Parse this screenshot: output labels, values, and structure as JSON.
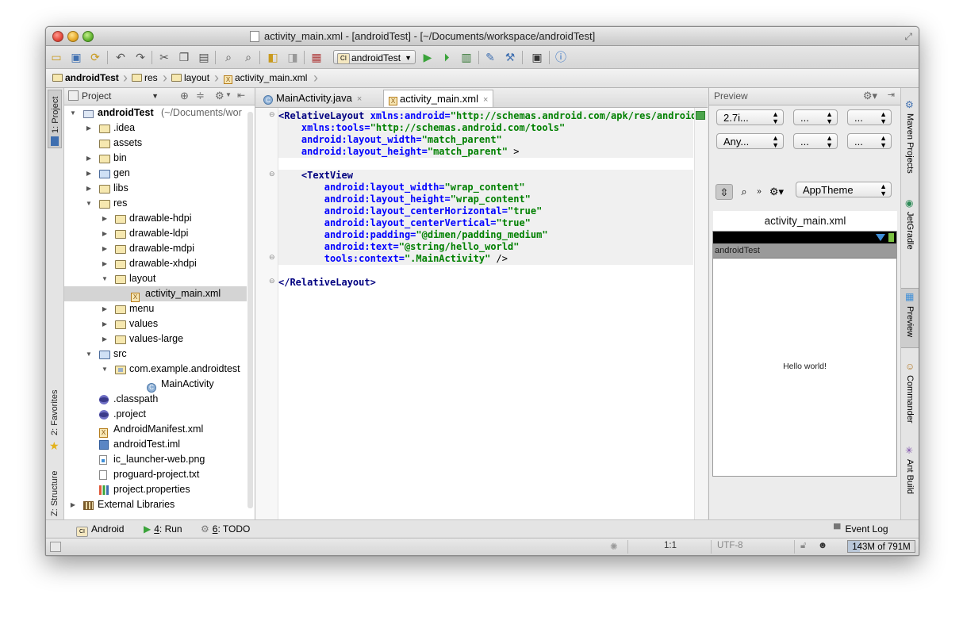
{
  "window": {
    "title": "activity_main.xml - [androidTest] - [~/Documents/workspace/androidTest]"
  },
  "toolbar": {
    "run_config": "androidTest",
    "run_config_badge": "CI"
  },
  "breadcrumbs": [
    "androidTest",
    "res",
    "layout",
    "activity_main.xml"
  ],
  "left_stripe": {
    "project": "1: Project",
    "favorites": "2: Favorites",
    "structure": "Z: Structure"
  },
  "project_panel": {
    "view_mode": "Project",
    "tree": [
      {
        "label": "androidTest",
        "suffix": " (~/Documents/wor",
        "depth": 0,
        "expanded": true,
        "icon": "module-folder-icon",
        "bold": true
      },
      {
        "label": ".idea",
        "depth": 1,
        "expanded": false,
        "icon": "folder-icon"
      },
      {
        "label": "assets",
        "depth": 1,
        "leaf": true,
        "icon": "folder-icon"
      },
      {
        "label": "bin",
        "depth": 1,
        "expanded": false,
        "icon": "folder-icon"
      },
      {
        "label": "gen",
        "depth": 1,
        "expanded": false,
        "icon": "source-folder-icon"
      },
      {
        "label": "libs",
        "depth": 1,
        "expanded": false,
        "icon": "folder-icon"
      },
      {
        "label": "res",
        "depth": 1,
        "expanded": true,
        "icon": "folder-icon"
      },
      {
        "label": "drawable-hdpi",
        "depth": 2,
        "expanded": false,
        "icon": "folder-icon"
      },
      {
        "label": "drawable-ldpi",
        "depth": 2,
        "expanded": false,
        "icon": "folder-icon"
      },
      {
        "label": "drawable-mdpi",
        "depth": 2,
        "expanded": false,
        "icon": "folder-icon"
      },
      {
        "label": "drawable-xhdpi",
        "depth": 2,
        "expanded": false,
        "icon": "folder-icon"
      },
      {
        "label": "layout",
        "depth": 2,
        "expanded": true,
        "icon": "folder-icon"
      },
      {
        "label": "activity_main.xml",
        "depth": 3,
        "leaf": true,
        "icon": "xml-file-icon",
        "selected": true
      },
      {
        "label": "menu",
        "depth": 2,
        "expanded": false,
        "icon": "folder-icon"
      },
      {
        "label": "values",
        "depth": 2,
        "expanded": false,
        "icon": "folder-icon"
      },
      {
        "label": "values-large",
        "depth": 2,
        "expanded": false,
        "icon": "folder-icon"
      },
      {
        "label": "src",
        "depth": 1,
        "expanded": true,
        "icon": "source-folder-icon"
      },
      {
        "label": "com.example.androidtest",
        "depth": 2,
        "expanded": true,
        "icon": "package-icon"
      },
      {
        "label": "MainActivity",
        "depth": 4,
        "leaf": true,
        "icon": "class-icon"
      },
      {
        "label": ".classpath",
        "depth": 1,
        "leaf": true,
        "icon": "eclipse-file-icon"
      },
      {
        "label": ".project",
        "depth": 1,
        "leaf": true,
        "icon": "eclipse-file-icon"
      },
      {
        "label": "AndroidManifest.xml",
        "depth": 1,
        "leaf": true,
        "icon": "xml-file-icon"
      },
      {
        "label": "androidTest.iml",
        "depth": 1,
        "leaf": true,
        "icon": "iml-file-icon"
      },
      {
        "label": "ic_launcher-web.png",
        "depth": 1,
        "leaf": true,
        "icon": "image-file-icon"
      },
      {
        "label": "proguard-project.txt",
        "depth": 1,
        "leaf": true,
        "icon": "text-file-icon"
      },
      {
        "label": "project.properties",
        "depth": 1,
        "leaf": true,
        "icon": "properties-file-icon"
      },
      {
        "label": "External Libraries",
        "depth": 0,
        "expanded": false,
        "icon": "libraries-icon"
      }
    ]
  },
  "editor": {
    "tabs": [
      {
        "label": "MainActivity.java",
        "icon": "class-icon",
        "active": false
      },
      {
        "label": "activity_main.xml",
        "icon": "xml-file-icon",
        "active": true
      }
    ],
    "lines": [
      [
        [
          "tag",
          "<RelativeLayout "
        ],
        [
          "attr",
          "xmlns:android="
        ],
        [
          "val",
          "\"http://schemas.android.com/apk/res/android\""
        ]
      ],
      [
        [
          "plain",
          "    "
        ],
        [
          "attr",
          "xmlns:tools="
        ],
        [
          "val",
          "\"http://schemas.android.com/tools\""
        ]
      ],
      [
        [
          "plain",
          "    "
        ],
        [
          "attr",
          "android:layout_width="
        ],
        [
          "val",
          "\"match_parent\""
        ]
      ],
      [
        [
          "plain",
          "    "
        ],
        [
          "attr",
          "android:layout_height="
        ],
        [
          "val",
          "\"match_parent\""
        ],
        [
          "plain",
          " >"
        ]
      ],
      [
        [
          "plain",
          ""
        ]
      ],
      [
        [
          "plain",
          "    "
        ],
        [
          "tag",
          "<TextView"
        ]
      ],
      [
        [
          "plain",
          "        "
        ],
        [
          "attr",
          "android:layout_width="
        ],
        [
          "val",
          "\"wrap_content\""
        ]
      ],
      [
        [
          "plain",
          "        "
        ],
        [
          "attr",
          "android:layout_height="
        ],
        [
          "val",
          "\"wrap_content\""
        ]
      ],
      [
        [
          "plain",
          "        "
        ],
        [
          "attr",
          "android:layout_centerHorizontal="
        ],
        [
          "val",
          "\"true\""
        ]
      ],
      [
        [
          "plain",
          "        "
        ],
        [
          "attr",
          "android:layout_centerVertical="
        ],
        [
          "val",
          "\"true\""
        ]
      ],
      [
        [
          "plain",
          "        "
        ],
        [
          "attr",
          "android:padding="
        ],
        [
          "val",
          "\"@dimen/padding_medium\""
        ]
      ],
      [
        [
          "plain",
          "        "
        ],
        [
          "attr",
          "android:text="
        ],
        [
          "val",
          "\"@string/hello_world\""
        ]
      ],
      [
        [
          "plain",
          "        "
        ],
        [
          "attr",
          "tools:context="
        ],
        [
          "val",
          "\".MainActivity\""
        ],
        [
          "plain",
          " />"
        ]
      ],
      [
        [
          "plain",
          ""
        ]
      ],
      [
        [
          "tag",
          "</RelativeLayout>"
        ]
      ]
    ]
  },
  "preview": {
    "title": "Preview",
    "row1": [
      "2.7i...",
      "...",
      "..."
    ],
    "row2": [
      "Any...",
      "...",
      "..."
    ],
    "theme": "AppTheme",
    "file_title": "activity_main.xml",
    "app_name": "androidTest",
    "hello_text": "Hello world!"
  },
  "right_stripe": [
    "Maven Projects",
    "JetGradle",
    "Preview",
    "Commander",
    "Ant Build"
  ],
  "bottom_tools": {
    "android": "Android",
    "run_num": "4",
    "run": ": Run",
    "todo_num": "6",
    "todo": ": TODO",
    "event_log": "Event Log"
  },
  "status": {
    "position": "1:1",
    "encoding": "UTF-8",
    "memory": "143M of 791M"
  }
}
